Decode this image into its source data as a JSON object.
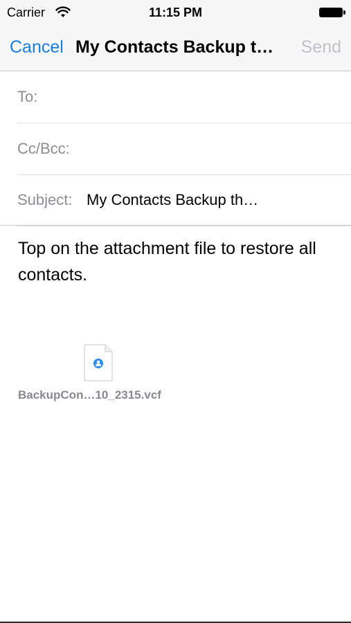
{
  "status_bar": {
    "carrier": "Carrier",
    "time": "11:15 PM",
    "icons": [
      "wifi-icon",
      "battery-icon"
    ]
  },
  "nav": {
    "cancel_label": "Cancel",
    "title": "My Contacts Backup t…",
    "send_label": "Send",
    "accent_color": "#1a7fe0",
    "disabled_color": "#c3c3c7"
  },
  "fields": {
    "to_label": "To:",
    "to_value": "",
    "cc_label": "Cc/Bcc:",
    "cc_value": "",
    "subject_label": "Subject:",
    "subject_value": "My Contacts Backup th…"
  },
  "body": {
    "text": "Top on the attachment file to restore all contacts."
  },
  "attachment": {
    "icon": "vcard-file-icon",
    "file_name": "BackupCon…10_2315.vcf"
  }
}
